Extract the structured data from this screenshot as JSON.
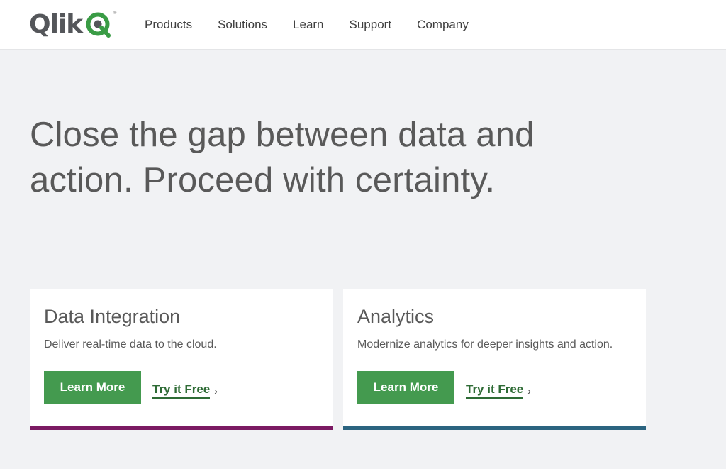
{
  "header": {
    "logo_text": "Qlik",
    "logo_mark": "Q",
    "nav": [
      "Products",
      "Solutions",
      "Learn",
      "Support",
      "Company"
    ]
  },
  "hero": {
    "line1": "Close the gap between data and",
    "line2": "action. Proceed with certainty."
  },
  "cards": [
    {
      "title": "Data Integration",
      "description": "Deliver real-time data to the cloud.",
      "primary_label": "Learn More",
      "secondary_label": "Try it Free",
      "accent_color": "#7b1a63"
    },
    {
      "title": "Analytics",
      "description": "Modernize analytics for deeper insights and action.",
      "primary_label": "Learn More",
      "secondary_label": "Try it Free",
      "accent_color": "#2b6480"
    }
  ],
  "colors": {
    "brand_green": "#449a4f",
    "link_green": "#2e6b35",
    "logo_gray": "#54565a"
  }
}
